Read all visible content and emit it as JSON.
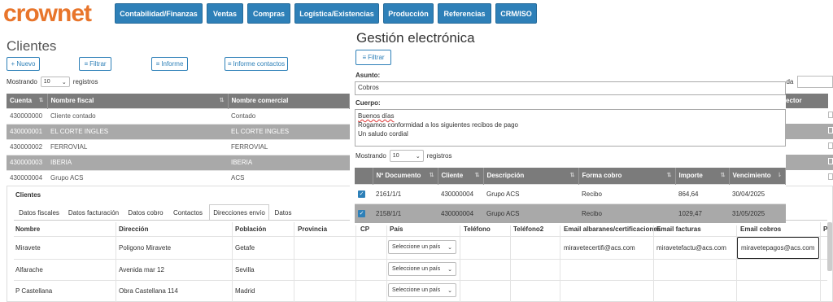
{
  "app": {
    "logo": "crownet"
  },
  "nav": [
    "Contabilidad/Finanzas",
    "Ventas",
    "Compras",
    "Logística/Existencias",
    "Producción",
    "Referencias",
    "CRM/ISO"
  ],
  "page": {
    "title": "Clientes",
    "new_label": "+ Nuevo",
    "filter_label": "Filtrar",
    "report_label": "Informe",
    "contacts_report_label": "Informe contactos",
    "showing_label": "Mostrando",
    "page_size": "10",
    "records_label": "registros",
    "search_fragment": "eda"
  },
  "clients_table": {
    "columns": [
      "Cuenta",
      "Nombre fiscal",
      "Nombre comercial"
    ],
    "rows": [
      {
        "cuenta": "430000000",
        "fiscal": "Cliente contado",
        "comercial": "Contado"
      },
      {
        "cuenta": "430000001",
        "fiscal": "EL CORTE INGLES",
        "comercial": "EL CORTE INGLES"
      },
      {
        "cuenta": "430000002",
        "fiscal": "FERROVIAL",
        "comercial": "FERROVIAL"
      },
      {
        "cuenta": "430000003",
        "fiscal": "IBERIA",
        "comercial": "IBERIA"
      },
      {
        "cuenta": "430000004",
        "fiscal": "Grupo ACS",
        "comercial": "ACS"
      }
    ],
    "right_header_fragment": "ector"
  },
  "bottom": {
    "title": "Clientes",
    "tabs": [
      "Datos fiscales",
      "Datos facturación",
      "Datos cobro",
      "Contactos",
      "Direcciones envío",
      "Datos"
    ],
    "active_tab": "Direcciones envío",
    "columns": {
      "nombre": "Nombre",
      "direccion": "Dirección",
      "poblacion": "Población",
      "provincia": "Provincia",
      "cp": "CP",
      "pais": "País",
      "telefono": "Teléfono",
      "telefono2": "Teléfono2",
      "email_albaranes": "Email albaranes/certificaciones",
      "email_facturas": "Email facturas",
      "email_cobros": "Email cobros",
      "extra": "Pl"
    },
    "rows": [
      {
        "nombre": "Miravete",
        "direccion": "Poligono Miravete",
        "poblacion": "Getafe",
        "pais": "Seleccione un país",
        "email_albaranes": "miravetecertifi@acs.com",
        "email_facturas": "miravetefactu@acs.com",
        "email_cobros": "miravetepagos@acs.com"
      },
      {
        "nombre": "Alfarache",
        "direccion": "Avenida mar 12",
        "poblacion": "Sevilla",
        "pais": "Seleccione un país"
      },
      {
        "nombre": "P Castellana",
        "direccion": "Obra Castellana 114",
        "poblacion": "Madrid",
        "pais": "Seleccione un país"
      }
    ]
  },
  "modal": {
    "title": "Gestión electrónica",
    "filter_label": "Filtrar",
    "subject_label": "Asunto:",
    "subject_value": "Cobros",
    "body_label": "Cuerpo:",
    "body_lines": [
      "Buenos días",
      "Rogamos conformidad a los siguientes recibos de pago",
      "Un saludo cordial"
    ],
    "showing_label": "Mostrando",
    "page_size": "10",
    "records_label": "registros",
    "table": {
      "columns": [
        "Nº Documento",
        "Cliente",
        "Descripción",
        "Forma cobro",
        "Importe",
        "Vencimiento"
      ],
      "rows": [
        {
          "doc": "2161/1/1",
          "cliente": "430000004",
          "desc": "Grupo ACS",
          "forma": "Recibo",
          "importe": "864,64",
          "venc": "30/04/2025",
          "checked": true
        },
        {
          "doc": "2158/1/1",
          "cliente": "430000004",
          "desc": "Grupo ACS",
          "forma": "Recibo",
          "importe": "1029,47",
          "venc": "31/05/2025",
          "checked": true
        }
      ]
    }
  },
  "colors": {
    "accent": "#2e80b8",
    "logo": "#e8752b",
    "header_gray": "#7b7b7b",
    "selected_row": "#a9a9a9"
  }
}
